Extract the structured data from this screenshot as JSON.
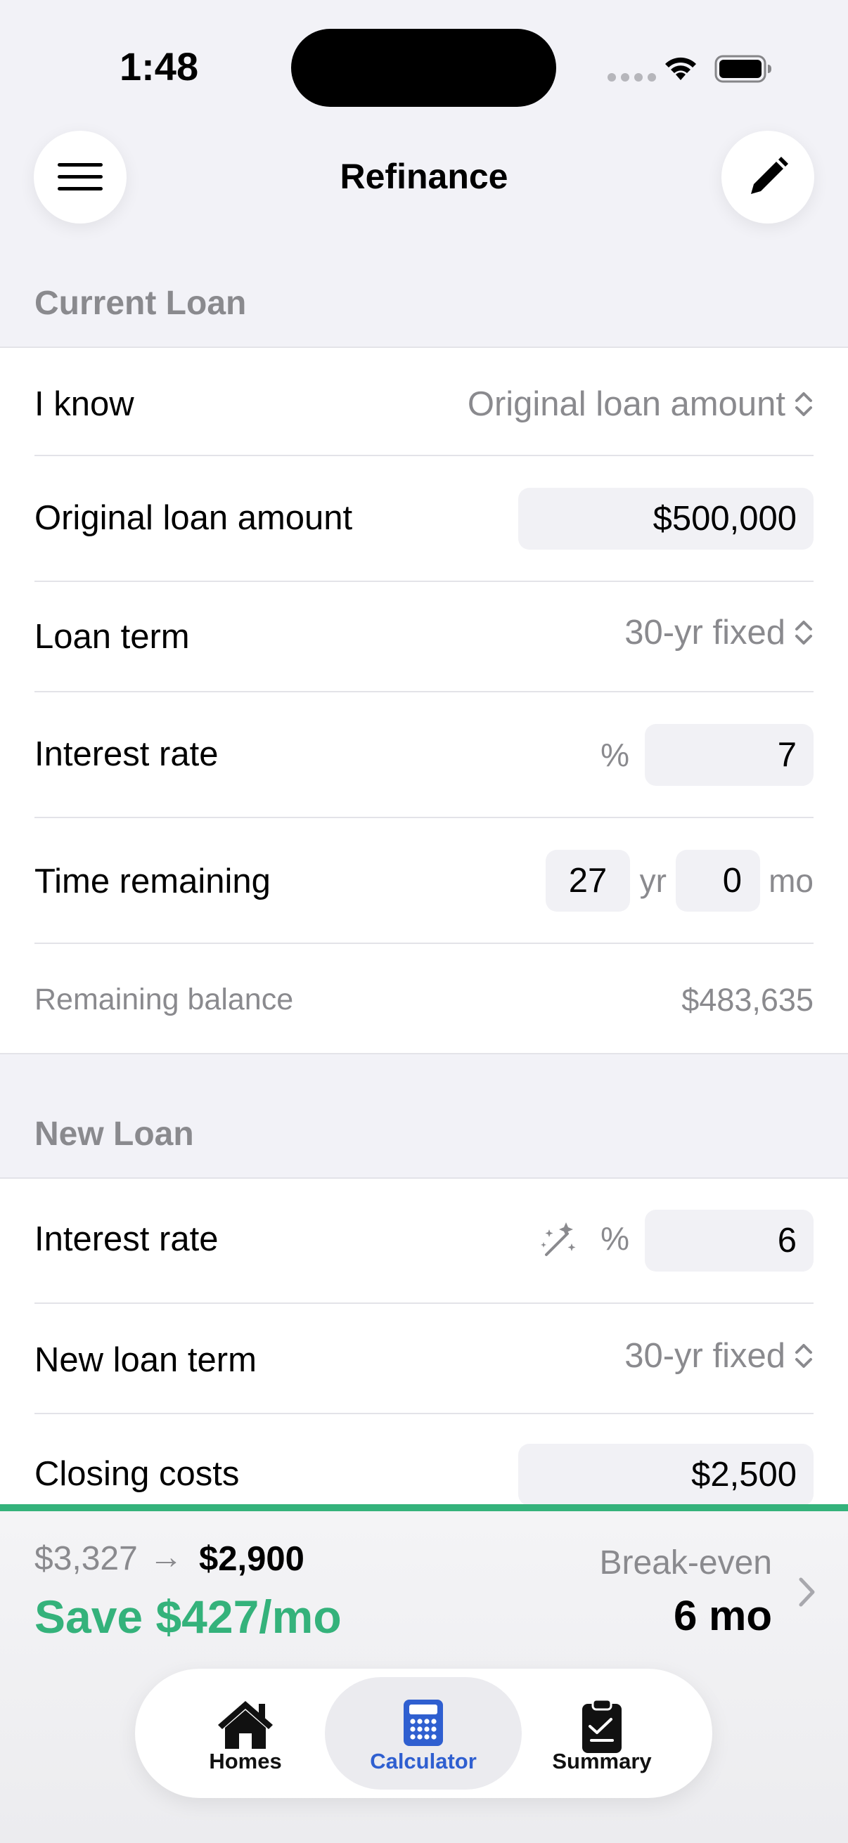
{
  "status_bar": {
    "time": "1:48"
  },
  "nav": {
    "title": "Refinance"
  },
  "current_loan": {
    "header": "Current Loan",
    "i_know_label": "I know",
    "i_know_value": "Original loan amount",
    "original_amount_label": "Original loan amount",
    "original_amount_value": "$500,000",
    "loan_term_label": "Loan term",
    "loan_term_value": "30-yr fixed",
    "interest_rate_label": "Interest rate",
    "interest_rate_unit": "%",
    "interest_rate_value": "7",
    "time_remaining_label": "Time remaining",
    "time_remaining_years": "27",
    "years_unit": "yr",
    "time_remaining_months": "0",
    "months_unit": "mo",
    "remaining_balance_label": "Remaining balance",
    "remaining_balance_value": "$483,635"
  },
  "new_loan": {
    "header": "New Loan",
    "interest_rate_label": "Interest rate",
    "interest_rate_unit": "%",
    "interest_rate_value": "6",
    "loan_term_label": "New loan term",
    "loan_term_value": "30-yr fixed",
    "closing_costs_label": "Closing costs",
    "closing_costs_value": "$2,500"
  },
  "summary": {
    "old_payment": "$3,327",
    "arrow": "→",
    "new_payment": "$2,900",
    "savings": "Save $427/mo",
    "breakeven_label": "Break-even",
    "breakeven_value": "6 mo"
  },
  "tabs": [
    {
      "label": "Homes",
      "icon": "house-icon",
      "active": false
    },
    {
      "label": "Calculator",
      "icon": "calculator-icon",
      "active": true
    },
    {
      "label": "Summary",
      "icon": "clipboard-icon",
      "active": false
    }
  ],
  "colors": {
    "accent_green": "#34b27b",
    "accent_blue": "#2f5fd0",
    "background": "#f2f2f7",
    "secondary_text": "#8a8a8e"
  }
}
